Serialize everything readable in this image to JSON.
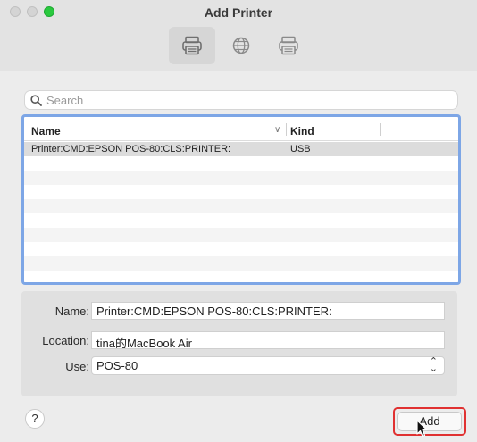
{
  "window": {
    "title": "Add Printer"
  },
  "toolbar": {
    "buttons": [
      {
        "icon": "printer-default-icon",
        "selected": true
      },
      {
        "icon": "globe-ip-icon",
        "selected": false
      },
      {
        "icon": "printer-windows-icon",
        "selected": false
      }
    ]
  },
  "search": {
    "placeholder": "Search",
    "value": ""
  },
  "table": {
    "columns": {
      "name": "Name",
      "kind": "Kind"
    },
    "rows": [
      {
        "name": "Printer:CMD:EPSON POS-80:CLS:PRINTER:",
        "kind": "USB",
        "selected": true
      }
    ],
    "empty_rows": 10
  },
  "details": {
    "name_label": "Name:",
    "name_value": "Printer:CMD:EPSON POS-80:CLS:PRINTER:",
    "location_label": "Location:",
    "location_value": "tina的MacBook Air",
    "use_label": "Use:",
    "use_value": "POS-80"
  },
  "footer": {
    "help_label": "?",
    "add_label": "Add"
  },
  "colors": {
    "accent_focus": "#7da6e6",
    "highlight_border": "#e03131",
    "zoom_green": "#2ac93f"
  }
}
